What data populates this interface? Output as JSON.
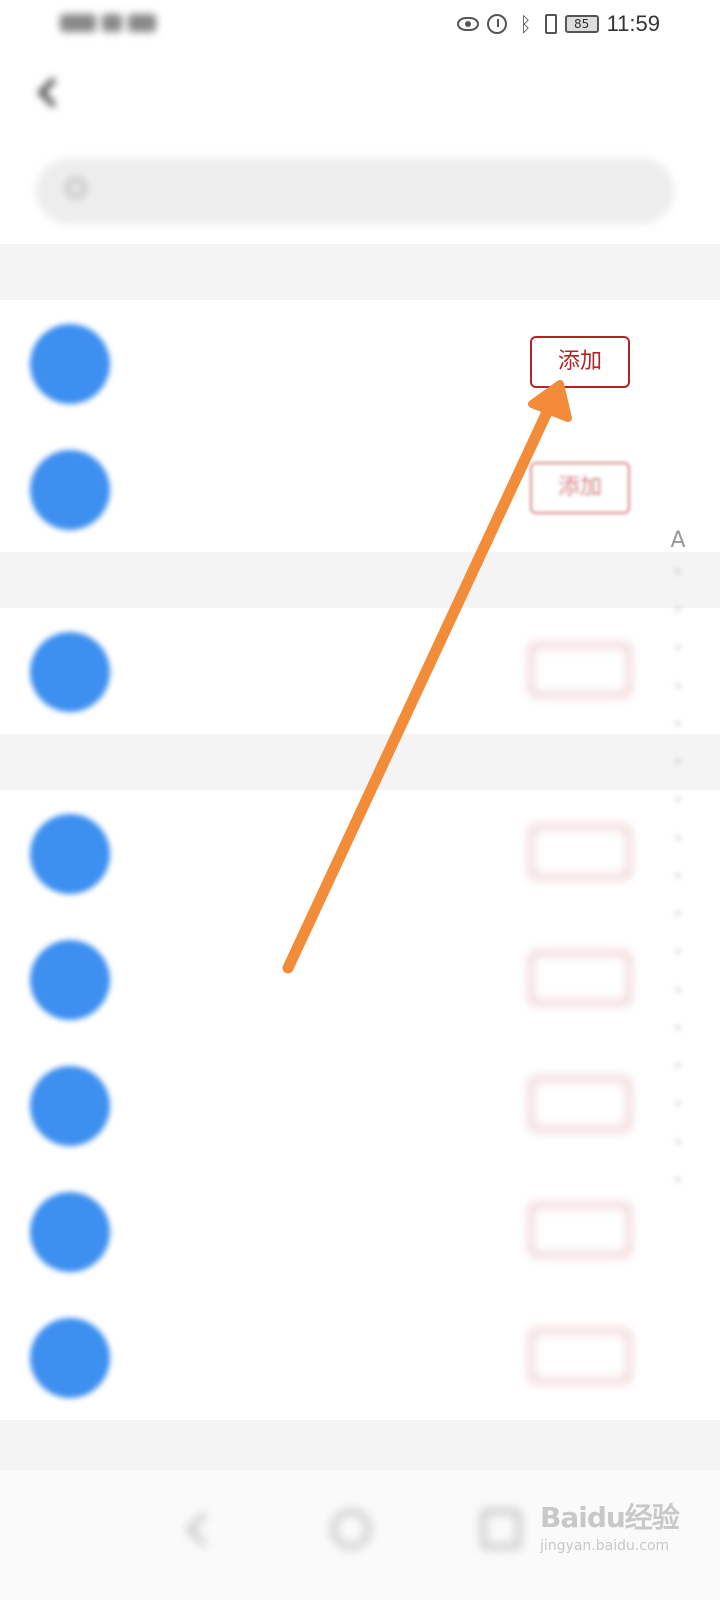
{
  "status_bar": {
    "battery": "85",
    "time": "11:59",
    "icons": [
      "eye-icon",
      "alarm-icon",
      "bluetooth-icon",
      "vibrate-icon",
      "battery-icon"
    ]
  },
  "contacts": [
    {
      "add_label": "添加",
      "emphasis": "highlighted"
    },
    {
      "add_label": "添加",
      "emphasis": "faded"
    }
  ],
  "index": {
    "first": "A"
  },
  "colors": {
    "accent_red": "#b42424",
    "avatar_blue": "#3d8ff0",
    "arrow_orange": "#f28c38"
  },
  "watermark": {
    "brand": "Baidu经验",
    "url": "jingyan.baidu.com"
  }
}
